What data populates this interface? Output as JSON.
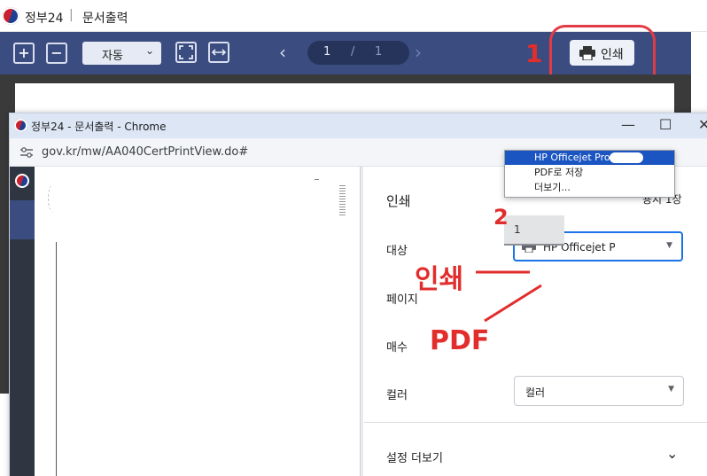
{
  "back_window": {
    "title": "정부24",
    "separator": "|",
    "page_title": "문서출력",
    "toolbar": {
      "zoom_in_icon": "plus-square-icon",
      "zoom_out_icon": "minus-square-icon",
      "zoom_value": "자동",
      "fit_page_icon": "fit-page-icon",
      "fit_width_icon": "fit-width-icon",
      "page_current": "1",
      "page_sep": "/",
      "page_total": "1",
      "print_label": "인쇄"
    }
  },
  "annotations": {
    "step1": "1",
    "step2": "2",
    "print_note": "인쇄",
    "pdf_note": "PDF",
    "color": "#e22d2d"
  },
  "chrome_window": {
    "title": "정부24 - 문서출력 - Chrome",
    "url": "gov.kr/mw/AA040CertPrintView.do#",
    "controls": {
      "minimize": "—",
      "maximize": "☐",
      "close": "✕"
    }
  },
  "print_panel": {
    "heading": "인쇄",
    "sheet_count": "용지 1장",
    "destination_label": "대상",
    "destination_value": "HP Officejet Pro",
    "destination_options": [
      "HP Officejet Pro",
      "PDF로 저장",
      "더보기..."
    ],
    "pages_label": "페이지",
    "copies_label": "매수",
    "copies_value": "1",
    "color_label": "컬러",
    "color_value": "컬러",
    "more_settings": "설정 더보기"
  }
}
